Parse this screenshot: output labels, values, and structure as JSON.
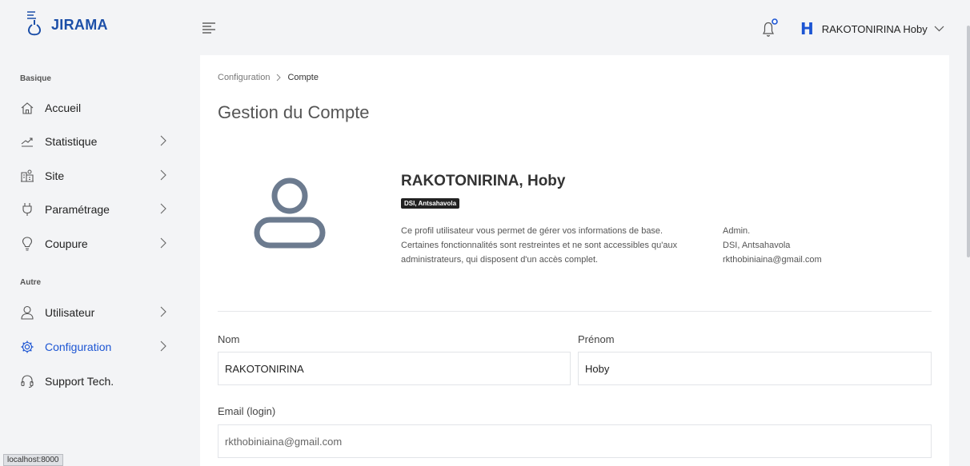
{
  "app": {
    "name": "JIRAMA"
  },
  "header": {
    "user_initial": "H",
    "user_name": "RAKOTONIRINA Hoby"
  },
  "sidebar": {
    "sections": [
      {
        "title": "Basique"
      },
      {
        "title": "Autre"
      }
    ],
    "items": [
      {
        "label": "Accueil"
      },
      {
        "label": "Statistique"
      },
      {
        "label": "Site"
      },
      {
        "label": "Paramétrage"
      },
      {
        "label": "Coupure"
      },
      {
        "label": "Utilisateur"
      },
      {
        "label": "Configuration"
      },
      {
        "label": "Support Tech."
      }
    ]
  },
  "breadcrumb": {
    "parent": "Configuration",
    "current": "Compte"
  },
  "page": {
    "title": "Gestion du Compte"
  },
  "profile": {
    "name": "RAKOTONIRINA, Hoby",
    "badge": "DSI, Antsahavola",
    "description": [
      "Ce profil utilisateur vous permet de gérer vos informations de base.",
      "Certaines fonctionnalités sont restreintes et ne sont accessibles qu'aux",
      "administrateurs, qui disposent d'un accès complet."
    ],
    "meta": [
      "Admin.",
      "DSI, Antsahavola",
      "rkthobiniaina@gmail.com"
    ]
  },
  "form": {
    "nom_label": "Nom",
    "nom_value": "RAKOTONIRINA",
    "prenom_label": "Prénom",
    "prenom_value": "Hoby",
    "email_label": "Email (login)",
    "email_value": "rkthobiniaina@gmail.com"
  },
  "status_bar": {
    "url": "localhost:8000"
  },
  "colors": {
    "brand": "#1c4fa8",
    "accent": "#1c55d3",
    "avatar": "#6c7b8f"
  }
}
